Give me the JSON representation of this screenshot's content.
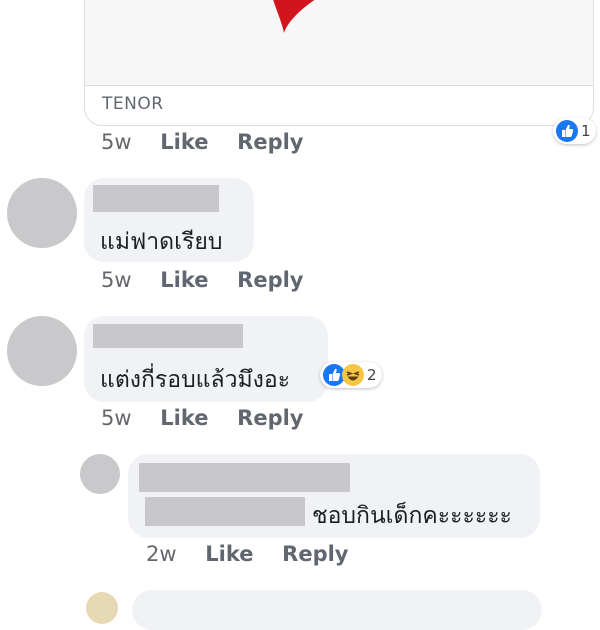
{
  "gif_card": {
    "source": "TENOR"
  },
  "comments": [
    {
      "time": "5w",
      "like": "Like",
      "reply": "Reply",
      "reaction_count": "1"
    },
    {
      "text": "แม่ฟาดเรียบ",
      "time": "5w",
      "like": "Like",
      "reply": "Reply"
    },
    {
      "text": "แต่งกี่รอบแล้วมึงอะ",
      "time": "5w",
      "like": "Like",
      "reply": "Reply",
      "reaction_count": "2"
    },
    {
      "text": "ชอบกินเด็กคะะะะะะ",
      "time": "2w",
      "like": "Like",
      "reply": "Reply"
    }
  ],
  "colors": {
    "bubble": "#f0f2f5",
    "redaction": "#c8c8cb",
    "like_blue": "#1877f2",
    "heart_red": "#d0151c"
  },
  "icons": [
    "heart-icon",
    "like-reaction-icon",
    "haha-reaction-icon"
  ]
}
